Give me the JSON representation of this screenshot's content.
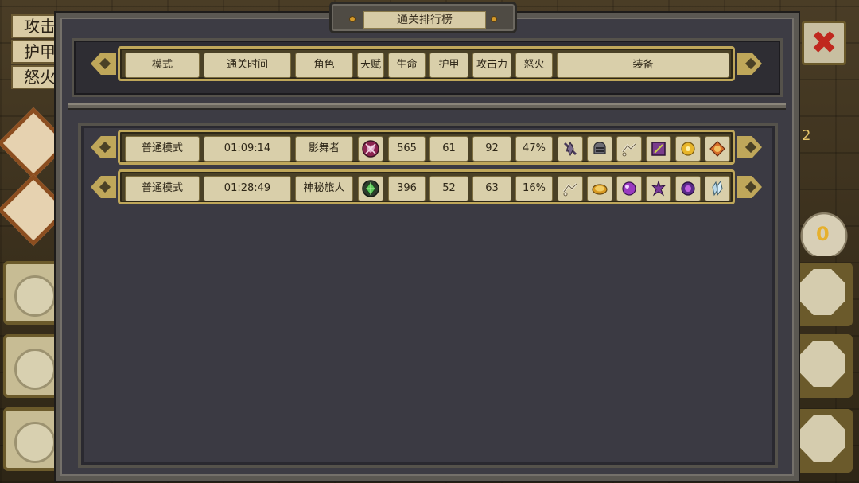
{
  "title": "通关排行榜",
  "background": {
    "stats": [
      "攻击",
      "护甲",
      "怒火"
    ],
    "counter": "2",
    "bag_count": "0",
    "close_glyph": "✖"
  },
  "header": {
    "mode": "模式",
    "time": "通关时间",
    "character": "角色",
    "talent": "天赋",
    "life": "生命",
    "armor": "护甲",
    "attack": "攻击力",
    "rage": "怒火",
    "equipment": "装备"
  },
  "rows": [
    {
      "mode": "普通模式",
      "time": "01:09:14",
      "character": "影舞者",
      "talent_icon": "crossed-heart-icon",
      "life": "565",
      "armor": "61",
      "attack": "92",
      "rage": "47%",
      "equipment": [
        "spiked-shield-icon",
        "helmet-icon",
        "bone-charm-icon",
        "purple-tablet-icon",
        "gold-flower-icon",
        "orange-crest-icon"
      ]
    },
    {
      "mode": "普通模式",
      "time": "01:28:49",
      "character": "神秘旅人",
      "talent_icon": "green-gem-icon",
      "life": "396",
      "armor": "52",
      "attack": "63",
      "rage": "16%",
      "equipment": [
        "bone-charm-icon",
        "gold-coin-icon",
        "purple-orb-icon",
        "purple-claw-icon",
        "violet-star-icon",
        "crystal-shard-icon"
      ]
    }
  ],
  "colors": {
    "cell_bg": "#d9cfaa",
    "row_frame": "#bfa75a",
    "window_bg": "#3d3c44",
    "close_red": "#c0281e"
  }
}
